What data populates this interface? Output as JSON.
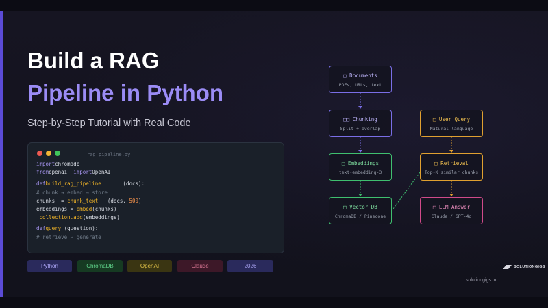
{
  "hero": {
    "title_line1": "Build a RAG",
    "title_line2": "Pipeline in Python",
    "subtitle": "Step-by-Step Tutorial with Real Code"
  },
  "code_panel": {
    "filename": "rag_pipeline.py",
    "lines": [
      [
        {
          "t": "import",
          "c": "kw"
        },
        {
          "t": "chromadb",
          "c": ""
        }
      ],
      [
        {
          "t": "from",
          "c": "kw"
        },
        {
          "t": "openai  ",
          "c": ""
        },
        {
          "t": "import",
          "c": "kw"
        },
        {
          "t": "OpenAI",
          "c": ""
        }
      ],
      [
        {
          "t": "def",
          "c": "kw"
        },
        {
          "t": "build_rag_pipeline",
          "c": "fn"
        },
        {
          "t": "       (docs):",
          "c": ""
        }
      ],
      [
        {
          "t": "# chunk → embed → store",
          "c": "cm"
        }
      ],
      [
        {
          "t": "chunks  = ",
          "c": ""
        },
        {
          "t": "chunk_text",
          "c": "fn"
        },
        {
          "t": "   (docs, ",
          "c": ""
        },
        {
          "t": "500",
          "c": "num"
        },
        {
          "t": ")",
          "c": ""
        }
      ],
      [
        {
          "t": "embeddings = ",
          "c": ""
        },
        {
          "t": "embed",
          "c": "fn"
        },
        {
          "t": "(chunks)",
          "c": ""
        }
      ],
      [
        {
          "t": " collection.add",
          "c": "fn"
        },
        {
          "t": "(embeddings)",
          "c": ""
        }
      ],
      [
        {
          "t": "def",
          "c": "kw"
        },
        {
          "t": "query ",
          "c": "fn"
        },
        {
          "t": "(question):",
          "c": ""
        }
      ],
      [
        {
          "t": "# retrieve → generate",
          "c": "cm"
        }
      ]
    ]
  },
  "tags": [
    {
      "label": "Python",
      "bg": "#2a2a5c",
      "fg": "#a9a3f2"
    },
    {
      "label": "ChromaDB",
      "bg": "#163a22",
      "fg": "#5fd28a"
    },
    {
      "label": "OpenAI",
      "bg": "#3a3512",
      "fg": "#e6c64a"
    },
    {
      "label": "Claude",
      "bg": "#3d1828",
      "fg": "#e07a98"
    },
    {
      "label": "2026",
      "bg": "#2a2a5c",
      "fg": "#a9a3f2"
    }
  ],
  "diagram": {
    "nodes": [
      {
        "id": "documents",
        "icon": "□",
        "title": "Documents",
        "sub": "PDFs, URLs, text",
        "color": "#7a6ee6",
        "title_color": "#b9b0f5"
      },
      {
        "id": "chunking",
        "icon": "□□",
        "title": "Chunking",
        "sub": "Split + overlap",
        "color": "#7a6ee6",
        "title_color": "#b9b0f5"
      },
      {
        "id": "embeddings",
        "icon": "□",
        "title": "Embeddings",
        "sub": "text-embedding-3",
        "color": "#3fbf6f",
        "title_color": "#7fe0a0"
      },
      {
        "id": "vector_db",
        "icon": "□",
        "title": "Vector DB",
        "sub": "ChromaDB / Pinecone",
        "color": "#3fbf6f",
        "title_color": "#7fe0a0"
      },
      {
        "id": "user_query",
        "icon": "□",
        "title": "User Query",
        "sub": "Natural language",
        "color": "#e0a030",
        "title_color": "#f0c050"
      },
      {
        "id": "retrieval",
        "icon": "□",
        "title": "Retrieval",
        "sub": "Top-K similar chunks",
        "color": "#e0a030",
        "title_color": "#f0c050"
      },
      {
        "id": "llm_answer",
        "icon": "□",
        "title": "LLM Answer",
        "sub": "Claude / GPT-4o",
        "color": "#d04a8a",
        "title_color": "#ee8fc0"
      }
    ]
  },
  "brand": {
    "logo_text": "SOLUTIONGIGS",
    "url": "solutiongigs.in"
  },
  "colors": {
    "accent": "#5b4bd6",
    "title_purple": "#9b8cf5",
    "dot_red": "#ee5a52",
    "dot_yellow": "#f2b535",
    "dot_green": "#3fc55a"
  }
}
